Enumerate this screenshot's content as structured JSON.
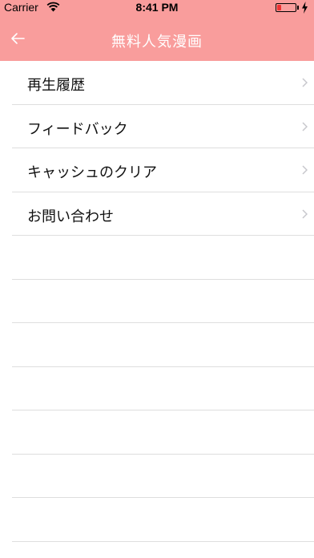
{
  "status_bar": {
    "carrier": "Carrier",
    "time": "8:41 PM"
  },
  "nav": {
    "title": "無料人気漫画",
    "back_icon": "arrow-left-icon"
  },
  "menu": {
    "items": [
      {
        "label": "再生履歴"
      },
      {
        "label": "フィードバック"
      },
      {
        "label": "キャッシュのクリア"
      },
      {
        "label": "お問い合わせ"
      }
    ]
  },
  "colors": {
    "header_bg": "#f99d9c",
    "title_text": "#ffffff",
    "separator": "#dedede",
    "chevron": "#c7c7cc",
    "battery_low": "#e33333"
  }
}
